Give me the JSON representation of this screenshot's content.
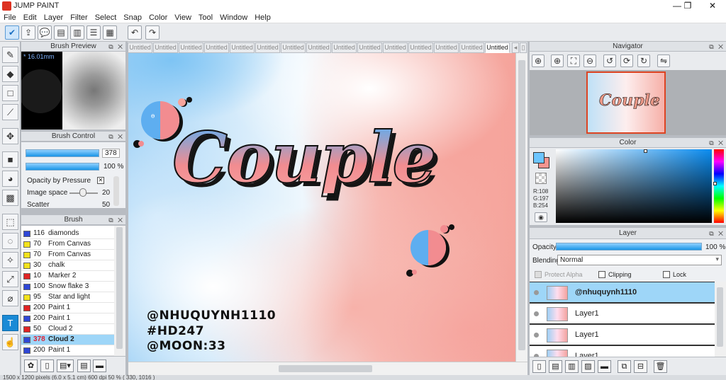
{
  "window": {
    "title": "JUMP PAINT",
    "minimize": "—",
    "maximize": "❐",
    "close": "✕"
  },
  "menu": [
    "File",
    "Edit",
    "Layer",
    "Filter",
    "Select",
    "Snap",
    "Color",
    "View",
    "Tool",
    "Window",
    "Help"
  ],
  "toolbar": {
    "icons": [
      "check-icon",
      "share-icon",
      "speech-icon",
      "comment-icon",
      "document-icon",
      "list-icon",
      "settings-grid-icon"
    ],
    "undo": "↶",
    "redo": "↷"
  },
  "tools": [
    "pen-icon",
    "eraser-icon",
    "select-rect-icon",
    "line-icon",
    "move-icon",
    "fill-rect-icon",
    "bucket-icon",
    "gradient-icon",
    "marquee-icon",
    "lasso-icon",
    "magic-wand-icon",
    "transform-icon",
    "eyedropper-icon",
    "text-icon",
    "hand-icon"
  ],
  "brush_preview": {
    "title": "Brush Preview",
    "size": "* 16.01mm"
  },
  "brush_control": {
    "title": "Brush Control",
    "size_value": "378",
    "opacity_value": "100 %",
    "size_fill": 1.0,
    "opacity_fill": 1.0,
    "opacity_by_pressure": "Opacity by Pressure",
    "image_space": "Image space",
    "image_space_value": "20",
    "scatter": "Scatter",
    "scatter_value": "50"
  },
  "brush": {
    "title": "Brush",
    "items": [
      {
        "size": "116",
        "name": "diamonds",
        "color": "#2f47d6"
      },
      {
        "size": "70",
        "name": "From Canvas",
        "color": "#f2e21d"
      },
      {
        "size": "70",
        "name": "From Canvas",
        "color": "#f2e21d"
      },
      {
        "size": "30",
        "name": "chalk",
        "color": "#f2e21d"
      },
      {
        "size": "10",
        "name": "Marker 2",
        "color": "#e02424"
      },
      {
        "size": "100",
        "name": "Snow flake 3",
        "color": "#2f47d6"
      },
      {
        "size": "95",
        "name": "Star and light",
        "color": "#f2e21d"
      },
      {
        "size": "200",
        "name": "Paint 1",
        "color": "#e02424"
      },
      {
        "size": "200",
        "name": "Paint 1",
        "color": "#2f47d6"
      },
      {
        "size": "50",
        "name": "Cloud 2",
        "color": "#e02424"
      },
      {
        "size": "378",
        "name": "Cloud 2",
        "color": "#2f47d6",
        "selected": true
      },
      {
        "size": "200",
        "name": "Paint 1",
        "color": "#2f47d6"
      }
    ]
  },
  "tabs": [
    "Untitled",
    "Untitled",
    "Untitled",
    "Untitled",
    "Untitled",
    "Untitled",
    "Untitled",
    "Untitled",
    "Untitled",
    "Untitled",
    "Untitled",
    "Untitled",
    "Untitled",
    "Untitled",
    "Untitled"
  ],
  "canvas": {
    "title_text": "Couple",
    "credit1": "@NHUQUYNH1110",
    "credit2": "#HD247",
    "credit3": "@MOON:33"
  },
  "navigator": {
    "title": "Navigator"
  },
  "color": {
    "title": "Color",
    "r": "R:108",
    "g": "G:197",
    "b": "B:254",
    "fg": "#6cc5fe",
    "bg": "#f4948f"
  },
  "layer": {
    "title": "Layer",
    "opacity_label": "Opacity",
    "opacity_value": "100 %",
    "opacity_fill": 1.0,
    "blending_label": "Blending",
    "blending_value": "Normal",
    "protect_alpha": "Protect Alpha",
    "clipping": "Clipping",
    "lock": "Lock",
    "items": [
      {
        "name": "@nhuquynh1110",
        "selected": true
      },
      {
        "name": "Layer1"
      },
      {
        "name": "Layer1"
      },
      {
        "name": "Layer1"
      }
    ]
  },
  "status": "1500 x 1200 pixels (6.0 x 5.1 cm)  600 dpi  50 %  ( 330, 1016 )"
}
